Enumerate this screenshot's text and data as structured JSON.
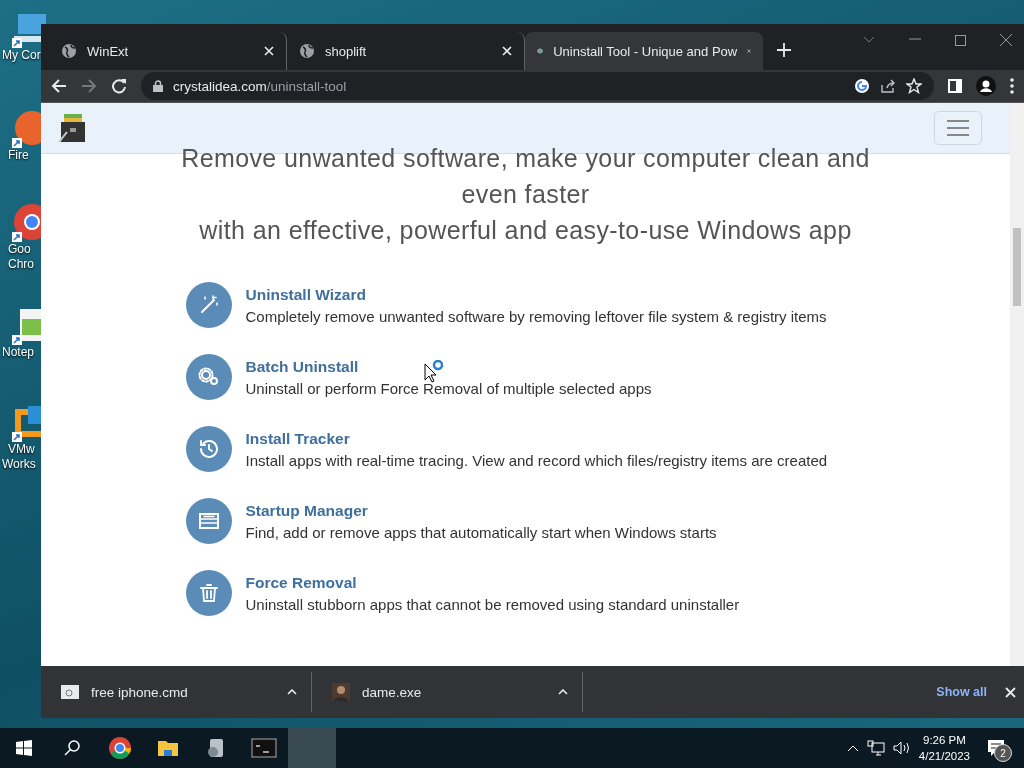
{
  "desktop_icons": [
    {
      "kind": "computer",
      "lines": [
        "My Cor"
      ]
    },
    {
      "kind": "firefox",
      "lines": [
        "Fire"
      ]
    },
    {
      "kind": "chrome",
      "lines": [
        "Goo",
        "Chro"
      ]
    },
    {
      "kind": "notepad",
      "lines": [
        "Notep"
      ]
    },
    {
      "kind": "vmware",
      "lines": [
        "VMw",
        "Works"
      ]
    }
  ],
  "browser": {
    "tabs": [
      {
        "title": "WinExt",
        "kind": "globe",
        "selected": false
      },
      {
        "title": "shoplift",
        "kind": "globe",
        "selected": false
      },
      {
        "title": "Uninstall Tool - Unique and Pow",
        "kind": "site",
        "selected": true
      }
    ],
    "address": {
      "domain": "crystalidea.com",
      "path": "/uninstall-tool"
    }
  },
  "page": {
    "headline": [
      "Remove unwanted software, make your computer clean and",
      "even faster",
      "with an effective, powerful and easy-to-use Windows app"
    ],
    "features": [
      {
        "kind": "wand",
        "title": "Uninstall Wizard",
        "text": "Completely remove unwanted software by removing leftover file system & registry items"
      },
      {
        "kind": "gears",
        "title": "Batch Uninstall",
        "text": "Uninstall or perform Force Removal of multiple selected apps"
      },
      {
        "kind": "history",
        "title": "Install Tracker",
        "text": "Install apps with real-time tracing. View and record which files/registry items are created"
      },
      {
        "kind": "list",
        "title": "Startup Manager",
        "text": "Find, add or remove apps that automatically start when Windows starts"
      },
      {
        "kind": "trash",
        "title": "Force Removal",
        "text": "Uninstall stubborn apps that cannot be removed using standard uninstaller"
      }
    ]
  },
  "downloads": {
    "items": [
      {
        "name": "free iphone.cmd",
        "kind": "script"
      },
      {
        "name": "dame.exe",
        "kind": "person"
      }
    ],
    "show_all": "Show all"
  },
  "taskbar": {
    "apps": [
      {
        "kind": "chrome",
        "selected": false
      },
      {
        "kind": "folder",
        "selected": false
      },
      {
        "kind": "installer",
        "selected": false
      },
      {
        "kind": "terminal",
        "selected": false
      },
      {
        "kind": "blank",
        "selected": true
      }
    ],
    "time": "9:26 PM",
    "date": "4/21/2023",
    "notifications": "2"
  }
}
